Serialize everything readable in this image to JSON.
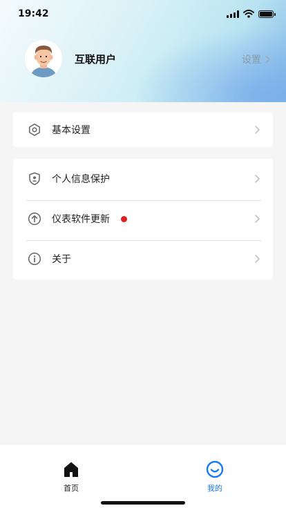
{
  "status_bar": {
    "time": "19:42"
  },
  "profile": {
    "username": "互联用户",
    "settings_label": "设置"
  },
  "menu": {
    "basic_settings": "基本设置",
    "privacy": "个人信息保护",
    "firmware_update": "仪表软件更新",
    "about": "关于"
  },
  "tabbar": {
    "home": "首页",
    "mine": "我的"
  },
  "colors": {
    "accent": "#1677ff",
    "badge": "#e02020"
  }
}
